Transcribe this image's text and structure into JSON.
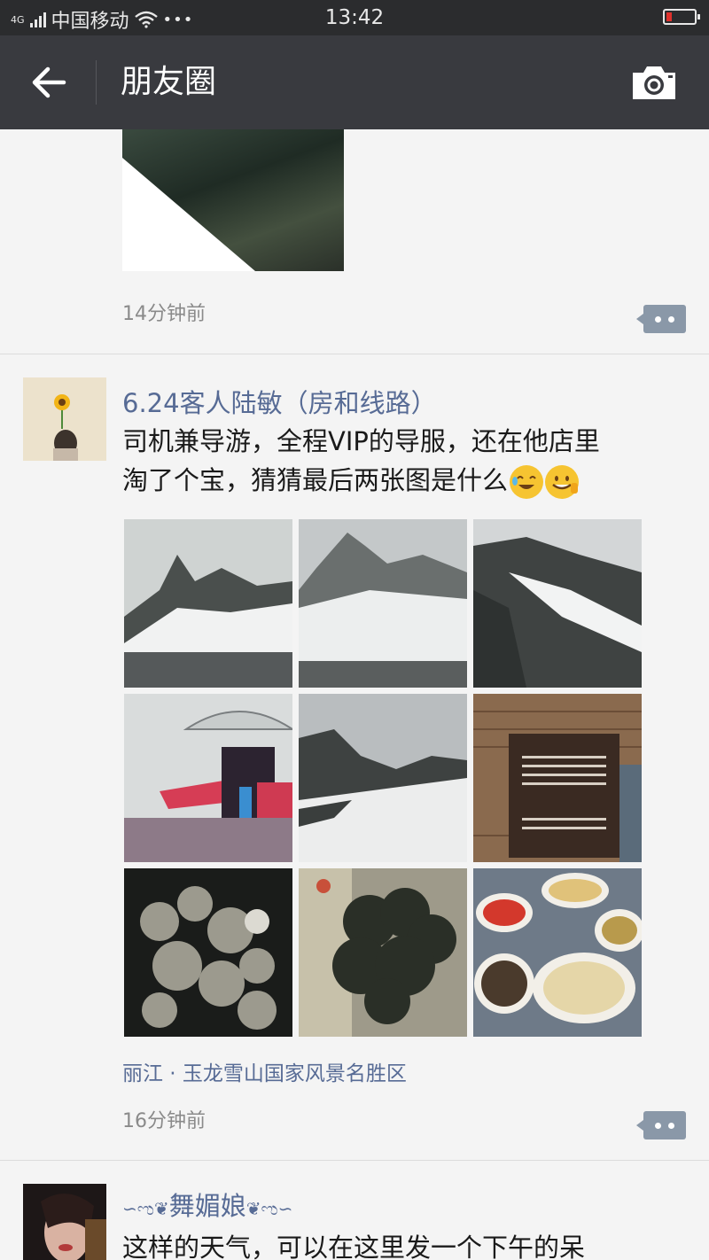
{
  "status_bar": {
    "network": "4G",
    "carrier": "中国移动",
    "dots": "•••",
    "time": "13:42"
  },
  "nav": {
    "title": "朋友圈"
  },
  "posts": [
    {
      "time": "14分钟前"
    },
    {
      "name": "6.24客人陆敏（房和线路）",
      "text_line1": "司机兼导游，全程VIP的导服，还在他店里",
      "text_line2": "淘了个宝，猜猜最后两张图是什么",
      "location": "丽江 · 玉龙雪山国家风景名胜区",
      "time": "16分钟前",
      "photos": [
        "snow-mountain-1",
        "snow-mountain-2",
        "snow-mountain-3",
        "person-umbrella",
        "snow-field",
        "safety-sign",
        "dried-fungus",
        "fungus-cluster",
        "food-plates"
      ]
    },
    {
      "name": "舞媚娘",
      "name_decor_left": "∽ಌ❦",
      "name_decor_right": "❦ಌ∽",
      "text_line1": "这样的天气，可以在这里发一个下午的呆"
    }
  ],
  "colors": {
    "nav_bg": "#393a3f",
    "status_bg": "#2b2c2e",
    "link_blue": "#576b95",
    "feed_bg": "#f4f4f4"
  }
}
